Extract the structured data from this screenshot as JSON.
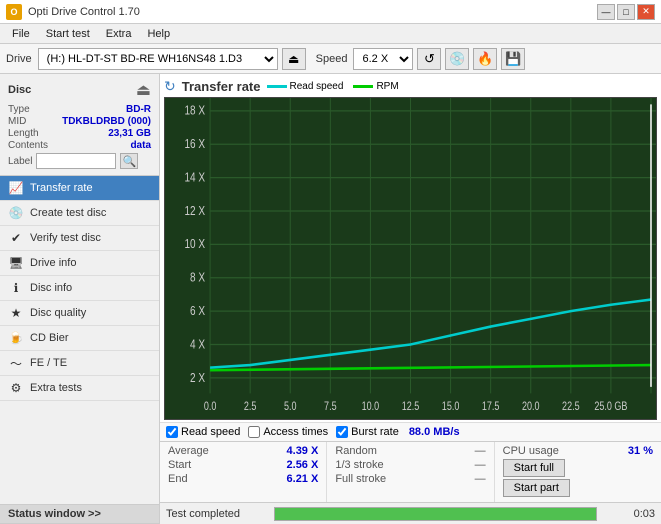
{
  "window": {
    "title": "Opti Drive Control 1.70",
    "controls": [
      "—",
      "□",
      "✕"
    ]
  },
  "menu": {
    "items": [
      "File",
      "Start test",
      "Extra",
      "Help"
    ]
  },
  "toolbar": {
    "drive_label": "Drive",
    "drive_value": "(H:) HL-DT-ST BD-RE  WH16NS48 1.D3",
    "speed_label": "Speed",
    "speed_value": "6.2 X"
  },
  "disc": {
    "title": "Disc",
    "type_label": "Type",
    "type_value": "BD-R",
    "mid_label": "MID",
    "mid_value": "TDKBLDRBD (000)",
    "length_label": "Length",
    "length_value": "23,31 GB",
    "contents_label": "Contents",
    "contents_value": "data",
    "label_label": "Label",
    "label_value": ""
  },
  "nav": {
    "items": [
      {
        "id": "transfer-rate",
        "label": "Transfer rate",
        "active": true
      },
      {
        "id": "create-test-disc",
        "label": "Create test disc",
        "active": false
      },
      {
        "id": "verify-test-disc",
        "label": "Verify test disc",
        "active": false
      },
      {
        "id": "drive-info",
        "label": "Drive info",
        "active": false
      },
      {
        "id": "disc-info",
        "label": "Disc info",
        "active": false
      },
      {
        "id": "disc-quality",
        "label": "Disc quality",
        "active": false
      },
      {
        "id": "cd-bier",
        "label": "CD Bier",
        "active": false
      },
      {
        "id": "fe-te",
        "label": "FE / TE",
        "active": false
      },
      {
        "id": "extra-tests",
        "label": "Extra tests",
        "active": false
      }
    ],
    "status_window": "Status window >>"
  },
  "chart": {
    "title": "Transfer rate",
    "icon": "↻",
    "legend": [
      {
        "label": "Read speed",
        "color": "#00cccc"
      },
      {
        "label": "RPM",
        "color": "#00cc00"
      }
    ],
    "y_axis": [
      "18 X",
      "16 X",
      "14 X",
      "12 X",
      "10 X",
      "8 X",
      "6 X",
      "4 X",
      "2 X"
    ],
    "x_axis": [
      "0.0",
      "2.5",
      "5.0",
      "7.5",
      "10.0",
      "12.5",
      "15.0",
      "17.5",
      "20.0",
      "22.5",
      "25.0 GB"
    ],
    "checkboxes": [
      {
        "label": "Read speed",
        "checked": true
      },
      {
        "label": "Access times",
        "checked": false
      },
      {
        "label": "Burst rate",
        "checked": true
      }
    ],
    "burst_rate_value": "88.0 MB/s"
  },
  "metrics": {
    "col1": [
      {
        "label": "Average",
        "value": "4.39 X"
      },
      {
        "label": "Start",
        "value": "2.56 X"
      },
      {
        "label": "End",
        "value": "6.21 X"
      }
    ],
    "col2": [
      {
        "label": "Random",
        "value": "—"
      },
      {
        "label": "1/3 stroke",
        "value": "—"
      },
      {
        "label": "Full stroke",
        "value": "—"
      }
    ],
    "col3": [
      {
        "label": "CPU usage",
        "value": "31 %"
      },
      {
        "btn1": "Start full"
      },
      {
        "btn2": "Start part"
      }
    ]
  },
  "status": {
    "text": "Test completed",
    "progress": 100,
    "time": "0:03"
  }
}
